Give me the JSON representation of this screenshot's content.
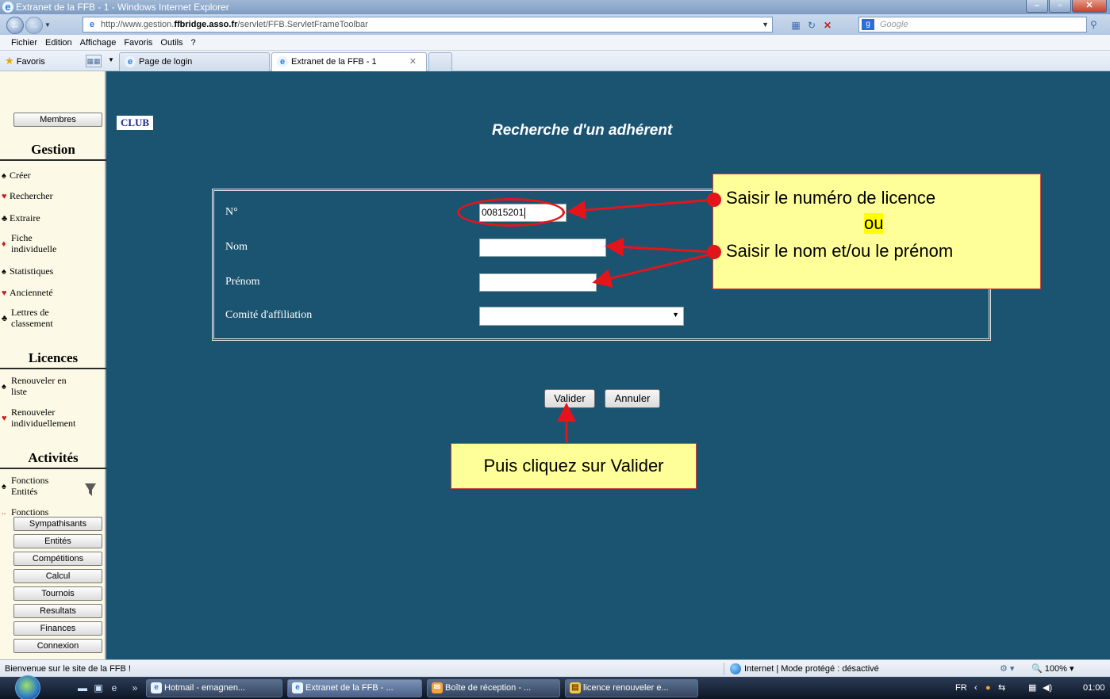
{
  "window": {
    "title": "Extranet de la FFB - 1 - Windows Internet Explorer"
  },
  "addressbar": {
    "url_prefix": "http://www.gestion.",
    "url_domain": "ffbridge.asso.fr",
    "url_path": "/servlet/FFB.ServletFrameToolbar",
    "search_placeholder": "Google"
  },
  "menubar": [
    "Fichier",
    "Edition",
    "Affichage",
    "Favoris",
    "Outils",
    "?"
  ],
  "favbar": {
    "favorites_label": "Favoris",
    "tabs": [
      {
        "label": "Page de login"
      },
      {
        "label": "Extranet de la FFB - 1"
      }
    ]
  },
  "sidebar": {
    "top_button": "Membres",
    "gestion_title": "Gestion",
    "gestion_items": {
      "creer": "Créer",
      "rechercher": "Rechercher",
      "extraire": "Extraire",
      "fiche1": "Fiche",
      "fiche2": "individuelle",
      "statistiques": "Statistiques",
      "anciennete": "Ancienneté",
      "lettres1": "Lettres de",
      "lettres2": "classement"
    },
    "licences_title": "Licences",
    "licences_items": {
      "renliste1": "Renouveler en",
      "renliste2": "liste",
      "renind1": "Renouveler",
      "renind2": "individuellement"
    },
    "activites_title": "Activités",
    "activites_items": {
      "fonct1": "Fonctions",
      "fonct2": "Entités",
      "fonct3": "Fonctions"
    },
    "bottom_buttons": {
      "sympathisants": "Sympathisants",
      "entites": "Entités",
      "competitions": "Compétitions",
      "calcul": "Calcul",
      "tournois": "Tournois",
      "resultats": "Resultats",
      "finances": "Finances",
      "connexion": "Connexion"
    }
  },
  "main": {
    "club_badge": "CLUB",
    "title": "Recherche d'un adhérent",
    "form": {
      "numero_label": "N°",
      "numero_value": "00815201",
      "nom_label": "Nom",
      "nom_value": "",
      "prenom_label": "Prénom",
      "prenom_value": "",
      "comite_label": "Comité d'affiliation",
      "comite_value": ""
    },
    "valider_label": "Valider",
    "annuler_label": "Annuler",
    "callout_line1": "Saisir le numéro de licence",
    "callout_ou": "ou",
    "callout_line2": "Saisir le nom et/ou le prénom",
    "callout_valider": "Puis cliquez sur Valider"
  },
  "statusbar": {
    "message": "Bienvenue sur le site de la FFB !",
    "zone": "Internet | Mode protégé : désactivé",
    "zoom": "100%"
  },
  "taskbar": {
    "items": {
      "hotmail": "Hotmail - emagnen...",
      "extranet": "Extranet de la FFB - ...",
      "reception": "Boîte de réception - ...",
      "licence": "licence renouveler e..."
    },
    "lang": "FR",
    "clock": "01:00"
  }
}
